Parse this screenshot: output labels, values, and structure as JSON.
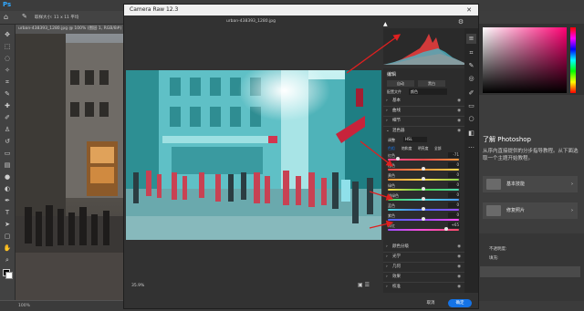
{
  "photoshop": {
    "doc_tab": "urban-438393_1280.jpg @ 100% (图层 1, RGB/8#)",
    "options": {
      "sample_size": "取样大小: 11 x 11 平均",
      "icons": [
        "home-icon",
        "eyedropper-icon"
      ]
    },
    "status": "100%",
    "learn": {
      "title": "了解 Photoshop",
      "desc": "从序内直接提供的分步指导教程。从下面选取一个主题开始教程。",
      "items": [
        "基本技能",
        "修复照片"
      ]
    },
    "layers": {
      "mode": "不透明度",
      "opacity_label": "不透明度:",
      "fill_label": "填充:"
    }
  },
  "camera_raw": {
    "title": "Camera Raw 12.3",
    "filename": "urban-438393_1280.jpg",
    "panel_title": "编辑",
    "auto_label": "自动",
    "bw_label": "黑白",
    "profile_label": "配置文件",
    "profile_value": "颜色",
    "sections_top": [
      "基本",
      "曲线",
      "细节"
    ],
    "mixer": {
      "title": "混色器",
      "adjust_label": "调整",
      "adjust_value": "HSL",
      "tabs": [
        "色相",
        "饱和度",
        "明亮度",
        "全部"
      ],
      "sliders": [
        {
          "label": "红色",
          "value": "-71"
        },
        {
          "label": "橙色",
          "value": "0"
        },
        {
          "label": "黄色",
          "value": "0"
        },
        {
          "label": "绿色",
          "value": "0"
        },
        {
          "label": "浅绿色",
          "value": "0"
        },
        {
          "label": "蓝色",
          "value": "0"
        },
        {
          "label": "紫色",
          "value": "0"
        },
        {
          "label": "洋红",
          "value": "+65"
        }
      ]
    },
    "sections_bottom": [
      "颜色分级",
      "光学",
      "几何",
      "效果",
      "校准"
    ],
    "zoom": "35.9%",
    "cancel": "取消",
    "ok": "确定"
  }
}
